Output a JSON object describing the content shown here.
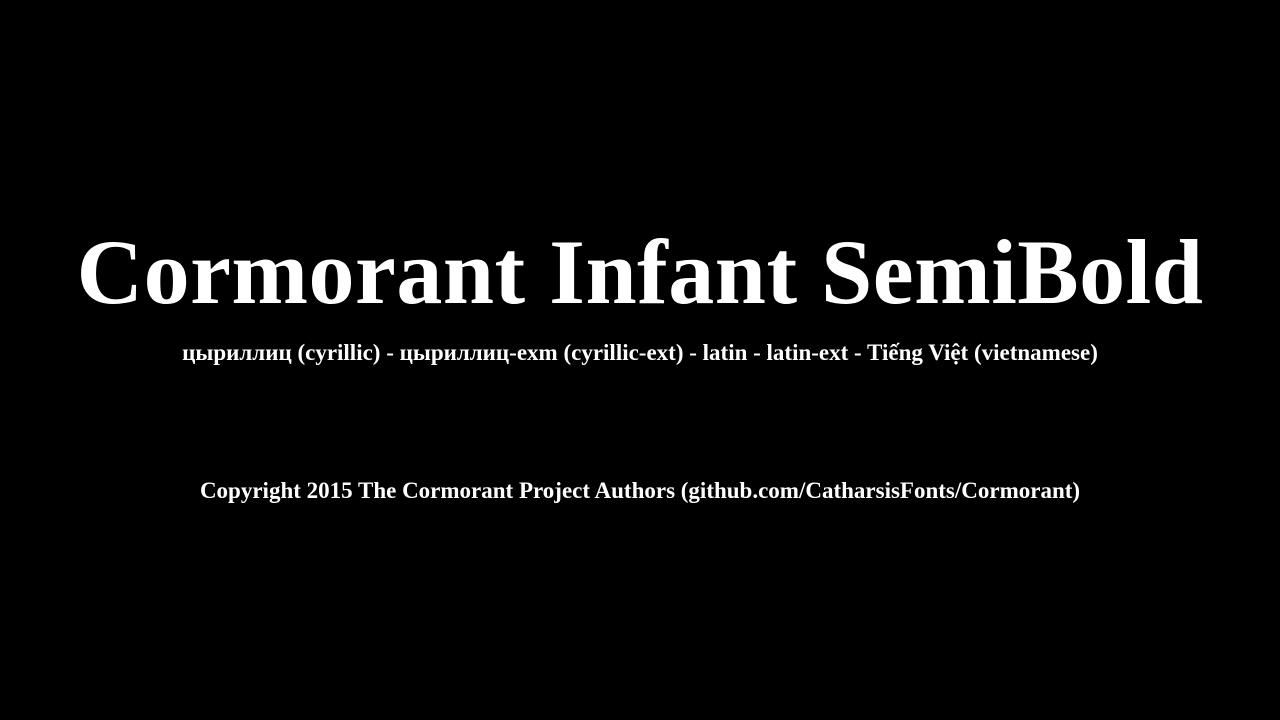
{
  "specimen": {
    "title": "Cormorant Infant SemiBold",
    "subtitle": "цыриллиц (cyrillic) - цыриллиц-exm (cyrillic-ext) - latin - latin-ext - Tiếng Việt (vietnamese)",
    "copyright": "Copyright 2015 The Cormorant Project Authors (github.com/CatharsisFonts/Cormorant)"
  },
  "colors": {
    "background": "#000000",
    "text": "#ffffff"
  }
}
